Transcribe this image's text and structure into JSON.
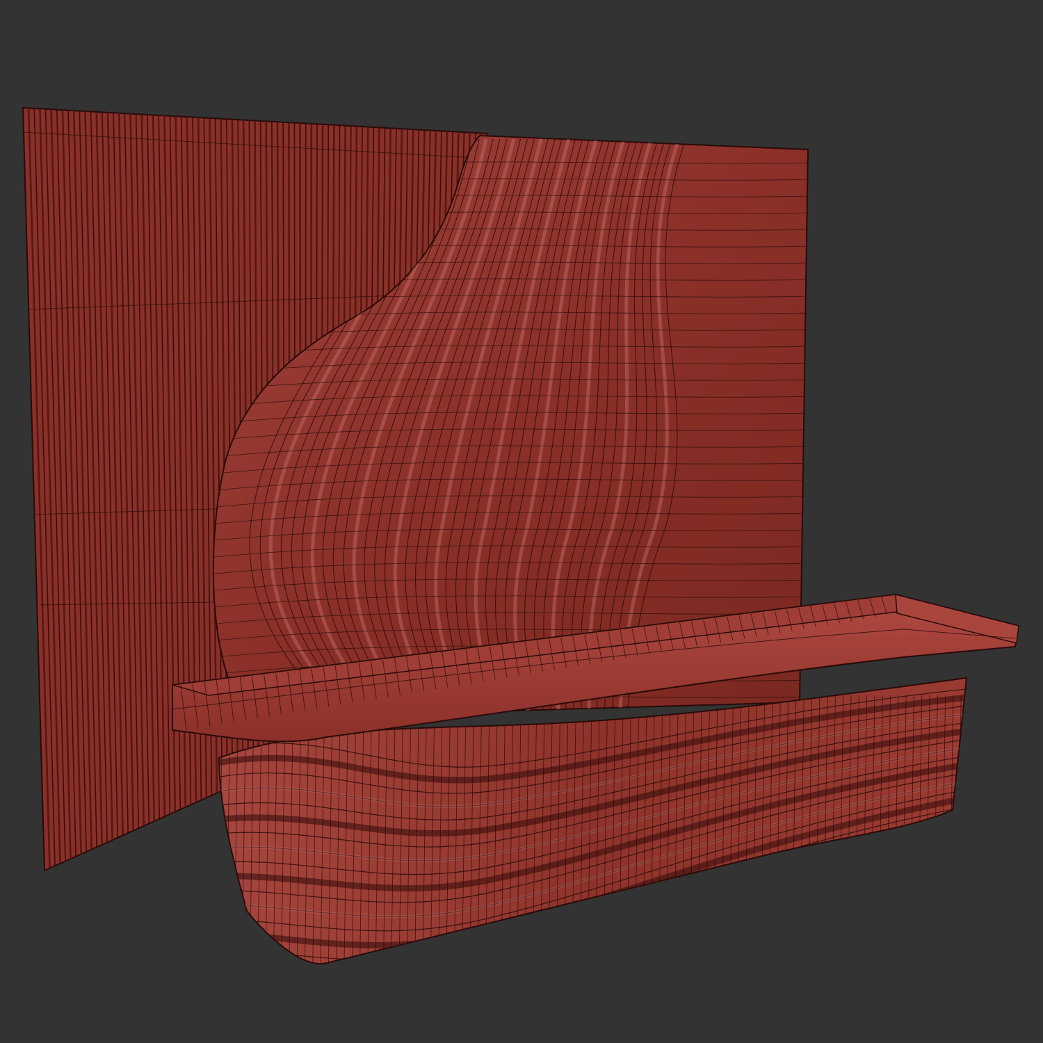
{
  "viewport": {
    "background": "#333333"
  },
  "model": {
    "shading": "wireframe-on-shaded",
    "material_color": "#8a3029",
    "wire_color": "#2a0a08",
    "highlight_color": "#c2706a",
    "shadow_color": "#4a1410",
    "parts": [
      "slatted-wall-panel",
      "curved-wave-panel",
      "reception-desk-counter",
      "desk-wavy-front"
    ]
  }
}
